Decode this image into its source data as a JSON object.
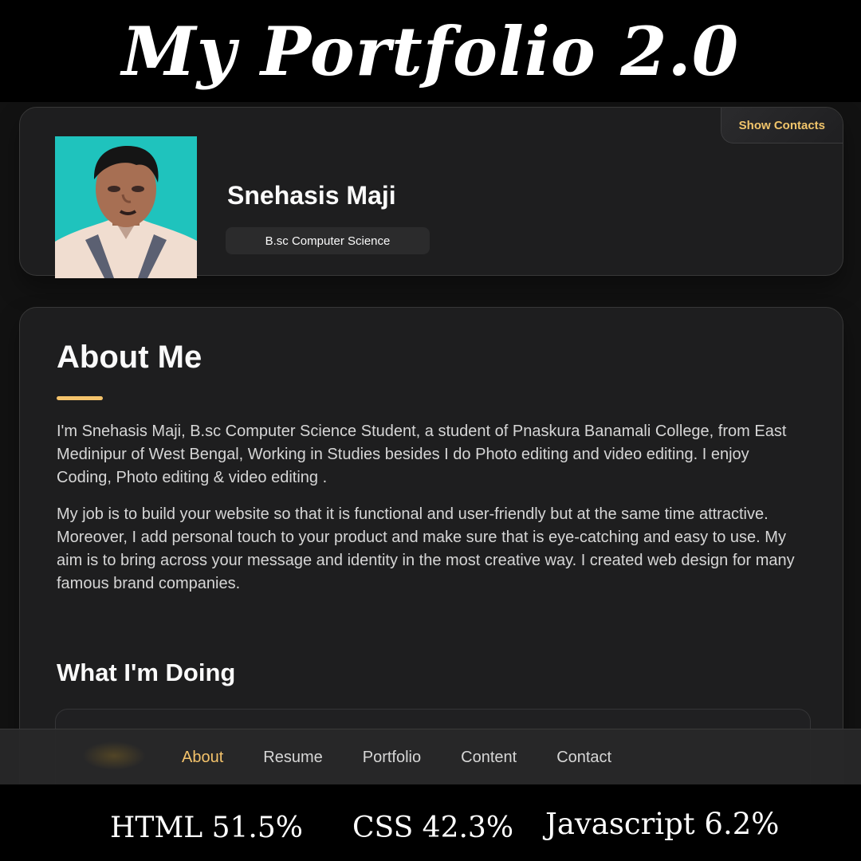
{
  "banner": {
    "title": "My Portfolio 2.0"
  },
  "profile": {
    "show_contacts_label": "Show Contacts",
    "name": "Snehasis Maji",
    "title": "B.sc Computer Science"
  },
  "about": {
    "title": "About Me",
    "paragraphs": [
      "I'm Snehasis Maji, B.sc Computer Science Student, a student of Pnaskura Banamali College, from East Medinipur of West Bengal, Working in Studies besides I do Photo editing and video editing. I enjoy Coding, Photo editing & video editing .",
      "My job is to build your website so that it is functional and user-friendly but at the same time attractive. Moreover, I add personal touch to your product and make sure that is eye-catching and easy to use. My aim is to bring across your message and identity in the most creative way. I created web design for many famous brand companies."
    ],
    "doing_title": "What I'm Doing"
  },
  "navbar": {
    "items": [
      "About",
      "Resume",
      "Portfolio",
      "Content",
      "Contact"
    ],
    "active": "About"
  },
  "stats": [
    "HTML 51.5%",
    "CSS 42.3%",
    "Javascript 6.2%"
  ],
  "colors": {
    "accent": "#f4c36b",
    "background": "#121212",
    "card": "#1e1e1f",
    "text": "#fafafa"
  }
}
